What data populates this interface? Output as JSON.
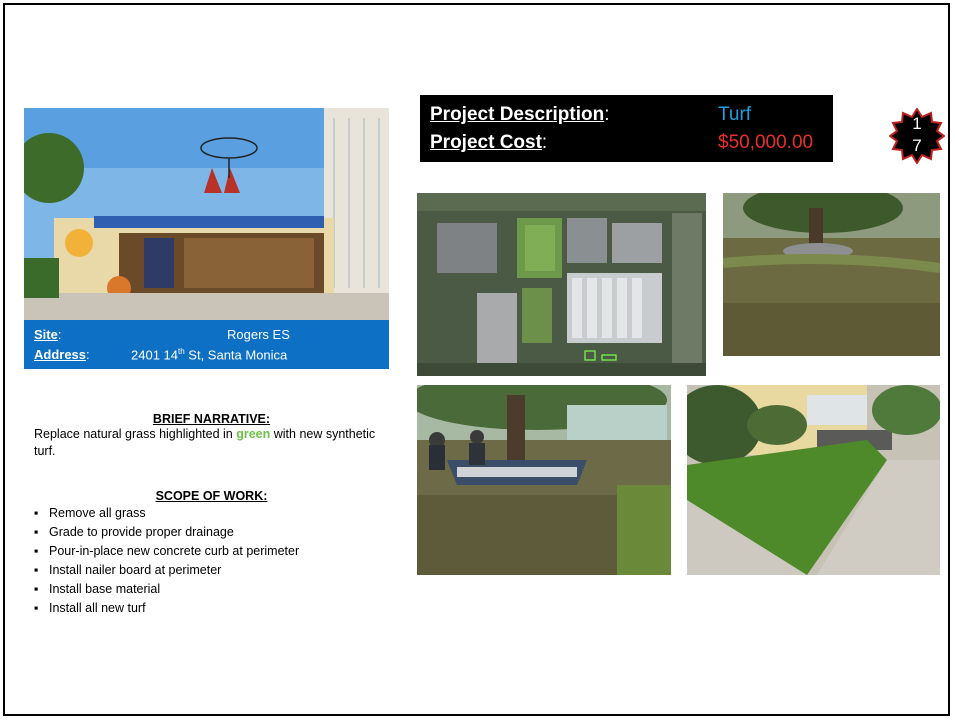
{
  "site": {
    "site_label": "Site",
    "site_colon": ":",
    "site_value": "Rogers ES",
    "address_label": "Address",
    "address_colon": ":",
    "address_pre": "2401 14",
    "address_sup": "th",
    "address_post": " St, Santa Monica"
  },
  "project": {
    "desc_label": "Project Description",
    "desc_colon": ":",
    "desc_value": "Turf",
    "cost_label": "Project Cost",
    "cost_colon": ":",
    "cost_value": "$50,000.00",
    "desc_color": "#1e9fe0",
    "cost_color": "#e8302a"
  },
  "badge": {
    "line1": "1",
    "line2": "7",
    "color": "#c0201c"
  },
  "narrative": {
    "heading": "BRIEF NARRATIVE:",
    "text_pre": "Replace natural grass highlighted in ",
    "text_highlight": "green",
    "text_post": " with new synthetic turf."
  },
  "scope": {
    "heading": "SCOPE OF WORK:",
    "items": [
      "Remove all grass",
      "Grade to provide proper drainage",
      "Pour-in-place new concrete curb at perimeter",
      "Install nailer board at perimeter",
      "Install base material",
      "Install all new turf"
    ]
  },
  "photos": {
    "school": "school-entrance-photo",
    "aerial": "aerial-map-photo",
    "lawn": "lawn-tree-photo",
    "workers": "workers-tree-bench-photo",
    "sidewalk": "sidewalk-lawn-photo"
  }
}
